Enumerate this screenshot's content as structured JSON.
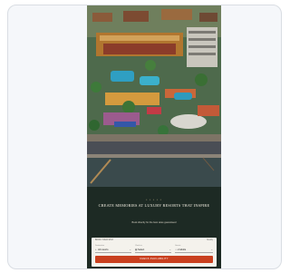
{
  "hero": {
    "eyebrow": "• • • • •",
    "headline": "CREATE MEMORIES AT LUXURY RESORTS THAT INSPIRE",
    "tagline": "Book directly for the best rates guaranteed"
  },
  "booking": {
    "label": "BOOK YOUR STAY",
    "link": "Modify",
    "destination": {
      "label": "Destination",
      "value": "All resorts"
    },
    "checkin": {
      "label": "Check-in",
      "value": "Select"
    },
    "guests": {
      "label": "Guests",
      "value": "2 Adults"
    },
    "cta": "CHECK AVAILABILITY"
  },
  "colors": {
    "accent": "#c9401f",
    "dark": "#1d2a24"
  }
}
